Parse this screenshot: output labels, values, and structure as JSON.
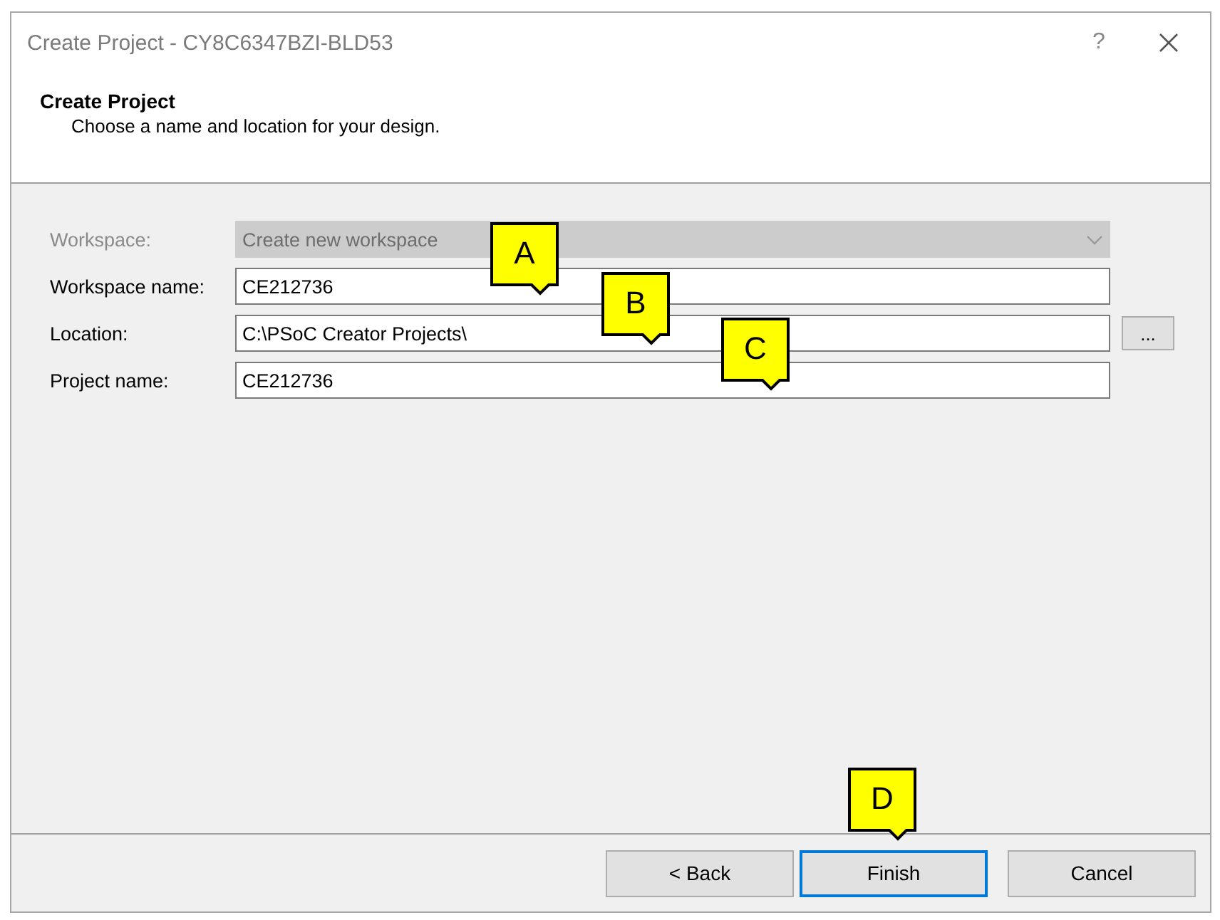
{
  "window": {
    "title": "Create Project - CY8C6347BZI-BLD53",
    "help": "?"
  },
  "header": {
    "title": "Create Project",
    "subtitle": "Choose a name and location for your design."
  },
  "fields": [
    {
      "kind": "combo",
      "label": "Workspace:",
      "value": "Create new workspace",
      "disabled": true
    },
    {
      "kind": "text",
      "label": "Workspace name:",
      "value": "CE212736",
      "disabled": false
    },
    {
      "kind": "browse",
      "label": "Location:",
      "value": "C:\\PSoC Creator Projects\\",
      "disabled": false,
      "button": "..."
    },
    {
      "kind": "text",
      "label": "Project name:",
      "value": "CE212736",
      "disabled": false
    }
  ],
  "buttons": [
    {
      "label": "< Back",
      "focused": false
    },
    {
      "label": "Finish",
      "focused": true
    },
    {
      "label": "Cancel",
      "focused": false
    }
  ],
  "callouts": [
    "A",
    "B",
    "C",
    "D"
  ]
}
